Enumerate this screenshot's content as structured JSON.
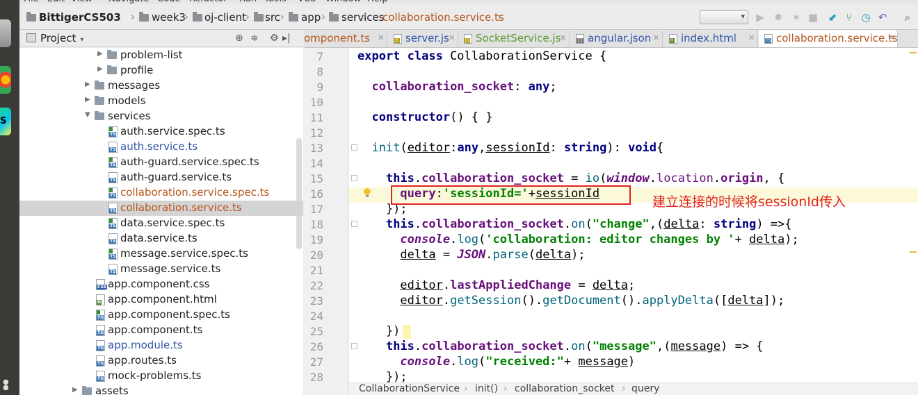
{
  "menubar": {
    "items": [
      "File",
      "Edit",
      "View",
      "Navigate",
      "Code",
      "Refactor",
      "Run",
      "Tools",
      "VCS",
      "Window",
      "Help"
    ]
  },
  "breadcrumb": [
    "BittigerCS503",
    "week3",
    "oj-client",
    "src",
    "app",
    "services",
    "collaboration.service.ts"
  ],
  "project_panel": {
    "title": "Project",
    "tree": [
      {
        "label": "problem-list",
        "kind": "folder",
        "depth": 2,
        "state": "collapsed"
      },
      {
        "label": "profile",
        "kind": "folder",
        "depth": 2,
        "state": "collapsed"
      },
      {
        "label": "messages",
        "kind": "folder",
        "depth": 1,
        "state": "collapsed"
      },
      {
        "label": "models",
        "kind": "folder",
        "depth": 1,
        "state": "collapsed"
      },
      {
        "label": "services",
        "kind": "folder",
        "depth": 1,
        "state": "expanded"
      },
      {
        "label": "auth.service.spec.ts",
        "kind": "ts",
        "depth": 2,
        "color": "normal"
      },
      {
        "label": "auth.service.ts",
        "kind": "ts",
        "depth": 2,
        "color": "blue"
      },
      {
        "label": "auth-guard.service.spec.ts",
        "kind": "ts",
        "depth": 2,
        "color": "normal"
      },
      {
        "label": "auth-guard.service.ts",
        "kind": "ts",
        "depth": 2,
        "color": "normal"
      },
      {
        "label": "collaboration.service.spec.ts",
        "kind": "ts",
        "depth": 2,
        "color": "orange"
      },
      {
        "label": "collaboration.service.ts",
        "kind": "ts",
        "depth": 2,
        "color": "orange",
        "selected": true
      },
      {
        "label": "data.service.spec.ts",
        "kind": "ts",
        "depth": 2,
        "color": "normal"
      },
      {
        "label": "data.service.ts",
        "kind": "ts",
        "depth": 2,
        "color": "normal"
      },
      {
        "label": "message.service.spec.ts",
        "kind": "ts",
        "depth": 2,
        "color": "normal"
      },
      {
        "label": "message.service.ts",
        "kind": "ts",
        "depth": 2,
        "color": "normal"
      },
      {
        "label": "app.component.css",
        "kind": "css",
        "depth": 1,
        "color": "normal"
      },
      {
        "label": "app.component.html",
        "kind": "html",
        "depth": 1,
        "color": "normal"
      },
      {
        "label": "app.component.spec.ts",
        "kind": "ts",
        "depth": 1,
        "color": "normal"
      },
      {
        "label": "app.component.ts",
        "kind": "ts",
        "depth": 1,
        "color": "normal"
      },
      {
        "label": "app.module.ts",
        "kind": "ts",
        "depth": 1,
        "color": "blue"
      },
      {
        "label": "app.routes.ts",
        "kind": "ts",
        "depth": 1,
        "color": "normal"
      },
      {
        "label": "mock-problems.ts",
        "kind": "ts",
        "depth": 1,
        "color": "normal"
      },
      {
        "label": "assets",
        "kind": "folder",
        "depth": 0,
        "state": "collapsed"
      }
    ]
  },
  "tabs": [
    {
      "label": "omponent.ts",
      "icon": "ts",
      "color": "orange"
    },
    {
      "label": "server.js",
      "icon": "js",
      "color": "blue"
    },
    {
      "label": "SocketService.js",
      "icon": "js",
      "color": "green"
    },
    {
      "label": "angular.json",
      "icon": "json",
      "color": "blue"
    },
    {
      "label": "index.html",
      "icon": "html",
      "color": "blue"
    },
    {
      "label": "collaboration.service.ts",
      "icon": "ts",
      "color": "orange",
      "active": true
    }
  ],
  "tab_overflow": "▾",
  "editor": {
    "line_numbers": [
      "7",
      "8",
      "9",
      "10",
      "11",
      "12",
      "13",
      "14",
      "15",
      "16",
      "17",
      "18",
      "19",
      "20",
      "21",
      "22",
      "23",
      "24",
      "25",
      "26",
      "27",
      "28"
    ],
    "annotation": "建立连接的时候将sessionId传入"
  },
  "status_path": [
    "CollaborationService",
    "init()",
    "collaboration_socket",
    "query"
  ],
  "colors": {
    "annotation": "#e2231a",
    "highlight_line": "#fbf9d9",
    "keyword": "#000080",
    "string": "#008000",
    "field": "#660e7a"
  },
  "icons": [
    "file-folder-icon",
    "chrome-icon",
    "webstorm-icon",
    "run-icon",
    "debug-icon",
    "stop-icon",
    "vcs-update-icon",
    "vcs-commit-icon",
    "undo-icon",
    "search-icon",
    "gear-icon",
    "lightbulb-icon"
  ]
}
